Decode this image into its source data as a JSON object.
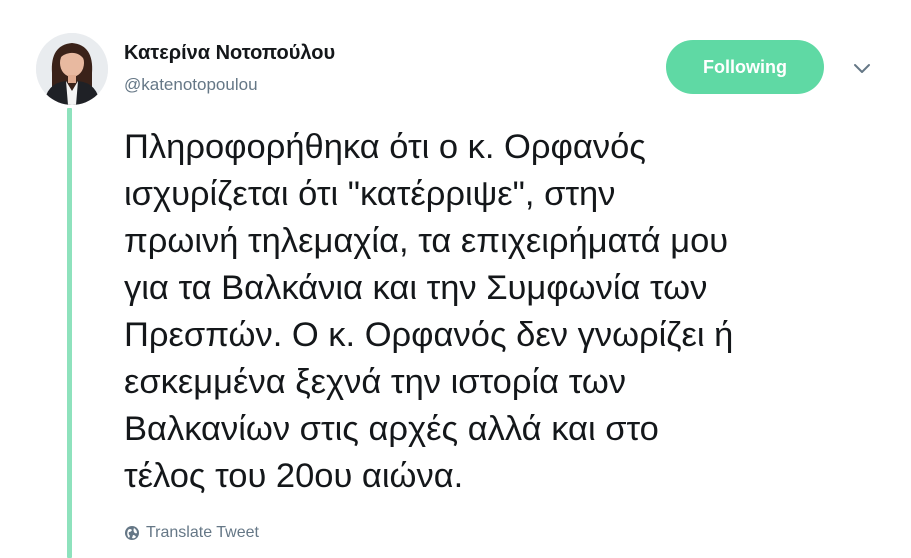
{
  "author": {
    "display_name": "Κατερίνα Νοτοπούλου",
    "handle": "@katenotopoulou"
  },
  "follow_button": {
    "label": "Following",
    "color": "#5fd9a4"
  },
  "tweet": {
    "text_lines": [
      "Πληροφορήθηκα ότι ο κ. Ορφανός",
      "ισχυρίζεται ότι \"κατέρριψε\", στην",
      "πρωινή τηλεμαχία, τα επιχειρήματά μου",
      "για τα Βαλκάνια και την Συμφωνία των",
      "Πρεσπών. Ο κ. Ορφανός δεν γνωρίζει ή",
      "εσκεμμένα ξεχνά την ιστορία των",
      "Βαλκανίων στις αρχές αλλά και στο",
      "τέλος του 20ου αιώνα."
    ]
  },
  "translate": {
    "label": "Translate Tweet",
    "icon": "globe-icon"
  },
  "icons": {
    "menu": "chevron-down-icon",
    "avatar": "profile-photo"
  },
  "colors": {
    "thread_line": "#8ee2bd",
    "text": "#14171a",
    "secondary_text": "#657786"
  }
}
